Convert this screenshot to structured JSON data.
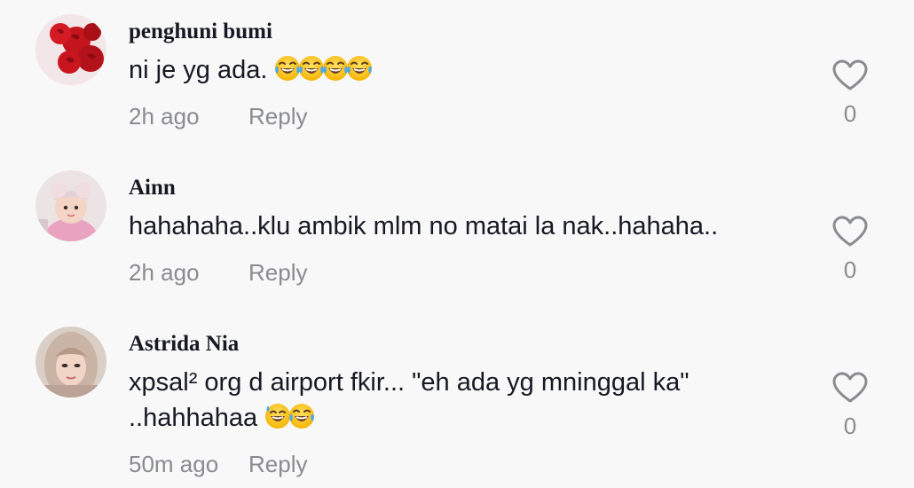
{
  "comments": [
    {
      "username": "penghuni bumi",
      "text_lines": [
        "ni je yg ada. "
      ],
      "emoji": [
        "joy",
        "joy",
        "joy",
        "joy"
      ],
      "time": "2h ago",
      "reply_label": "Reply",
      "likes": "0",
      "avatar": "red-roses"
    },
    {
      "username": "Ainn",
      "text_lines": [
        "hahahaha..klu ambik mlm no matai la nak..hahaha.."
      ],
      "emoji": [],
      "time": "2h ago",
      "reply_label": "Reply",
      "likes": "0",
      "avatar": "baby-photo"
    },
    {
      "username": "Astrida Nia",
      "text_lines": [
        "xpsal² org d airport fkir... \"eh ada yg mninggal ka\"",
        "..hahhahaa "
      ],
      "emoji": [
        "sweat-smile",
        "joy"
      ],
      "time": "50m ago",
      "reply_label": "Reply",
      "likes": "0",
      "avatar": "woman-hijab-photo"
    }
  ],
  "colors": {
    "background": "#f8f8f8",
    "text": "#161823",
    "secondary": "#8a8b91"
  }
}
